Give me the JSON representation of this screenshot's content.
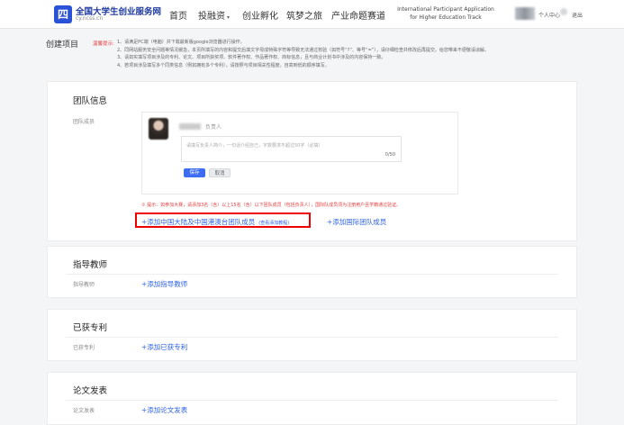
{
  "header": {
    "logo_mark": "四",
    "logo_title": "全国大学生创业服务网",
    "logo_subtitle": "cy.ncss.cn",
    "nav": [
      "首页",
      "投融资",
      "创业孵化",
      "筑梦之旅",
      "产业命题赛道"
    ],
    "intl_line1": "International Participant Application",
    "intl_line2": "for Higher Education Track",
    "user_center": "个人中心",
    "logout": "退出"
  },
  "intro": {
    "title": "创建项目",
    "tips_label": "温馨提示:",
    "tips": [
      "1、请满足PC端（电脑）并下载最新版google浏览器进行操作。",
      "2、同网站服务安全问题等情况缓急，本页所填写的内容和提交后填文字母成特殊字符等导致无法通过校验（如符号“?”、等号“=”），请仔细检查并修改后再提交。给您带来不便敬请谅解。",
      "3、请如实填写项目涉及的专利、论文、项目所获奖项、软件著作权、作品著作权、商标信息，且与商业计划书中涉及的内容保持一致。",
      "4、若项目涉及填写多个同类信息（例如拥有多个专利），请按照与项目相关性程度，自高到低的顺序填写。"
    ]
  },
  "team": {
    "title": "团队信息",
    "row_label": "团队成员",
    "member_role": "负责人",
    "intro_placeholder": "请填写负责人简介，一句话介绍自己，字数要求不超过50字（必填）",
    "counter": "0/50",
    "save": "保存",
    "cancel": "取消",
    "hint": "① 提示：如参加大赛，请添加3名（含）以上15名（含）以下团队成员（包括负责人），国际队成员须为注册用户且学籍通过验证。",
    "add_mainland": "+添加中国大陆及中国港澳台团队成员",
    "tutorial": "(查看添加教程)",
    "add_intl": "+添加国际团队成员"
  },
  "mentor": {
    "title": "指导教师",
    "row_label": "指导教师",
    "add": "+添加指导教师"
  },
  "patent": {
    "title": "已获专利",
    "row_label": "已获专利",
    "add": "+添加已获专利"
  },
  "paper": {
    "title": "论文发表",
    "row_label": "论文发表",
    "add": "+添加论文发表"
  }
}
